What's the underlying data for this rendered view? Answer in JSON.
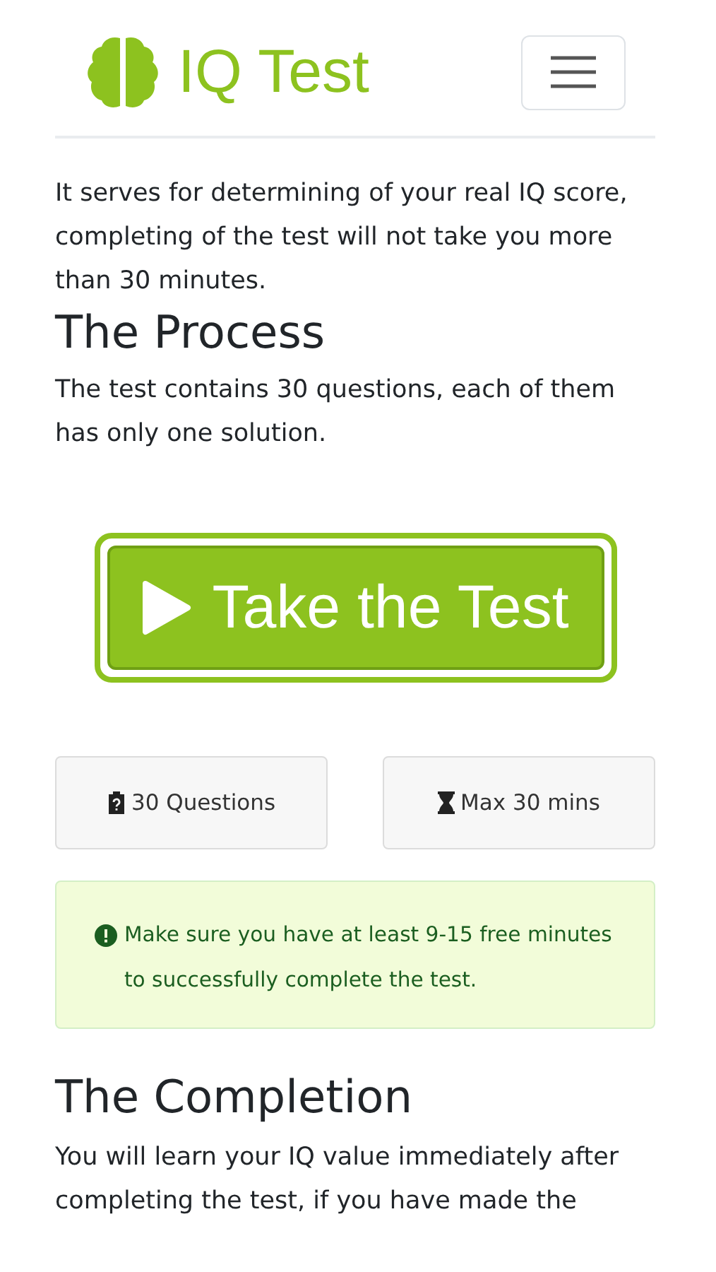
{
  "header": {
    "logo_text": "IQ Test"
  },
  "intro": "It serves for determining of your real IQ score, completing of the test will not take you more than 30 minutes.",
  "process": {
    "heading": "The Process",
    "text": "The test contains 30 questions, each of them has only one solution."
  },
  "cta": {
    "label": "Take the Test"
  },
  "stats": [
    {
      "kind": "questions",
      "label": "30 Questions"
    },
    {
      "kind": "time",
      "label": "Max 30 mins"
    }
  ],
  "alert": {
    "text": "Make sure you have at least 9-15 free minutes to successfully complete the test."
  },
  "completion": {
    "heading": "The Completion",
    "text": "You will learn your IQ value immediately after completing the test, if you have made the"
  }
}
